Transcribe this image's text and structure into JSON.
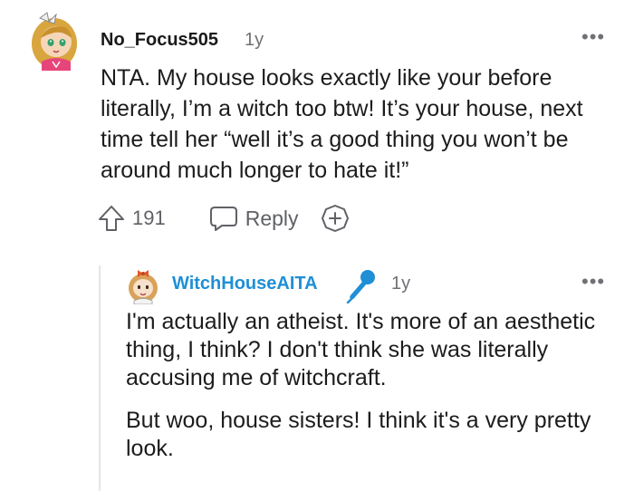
{
  "comment": {
    "username": "No_Focus505",
    "age": "1y",
    "more_label": "•••",
    "text": "NTA. My house looks exactly like your before literally, I’m a witch too btw! It’s your house, next time tell her “well it’s a good thing you won’t be around much longer to hate it!”",
    "actions": {
      "upvote_count": "191",
      "reply_label": "Reply",
      "upvote_icon": "upvote-arrow-icon",
      "reply_icon": "speech-bubble-icon",
      "award_icon": "plus-circle-icon"
    }
  },
  "reply": {
    "username": "WitchHouseAITA",
    "op_badge_icon": "microphone-icon",
    "age": "1y",
    "more_label": "•••",
    "paragraphs": [
      "I'm actually an atheist. It's more of an aesthetic thing, I think? I don't think she was literally accusing me of witchcraft.",
      "But woo, house sisters! I think it's a very pretty look."
    ]
  },
  "colors": {
    "username_op": "#1f8fd6",
    "meta_gray": "#6f7175",
    "mic_blue": "#1f8fd6"
  }
}
